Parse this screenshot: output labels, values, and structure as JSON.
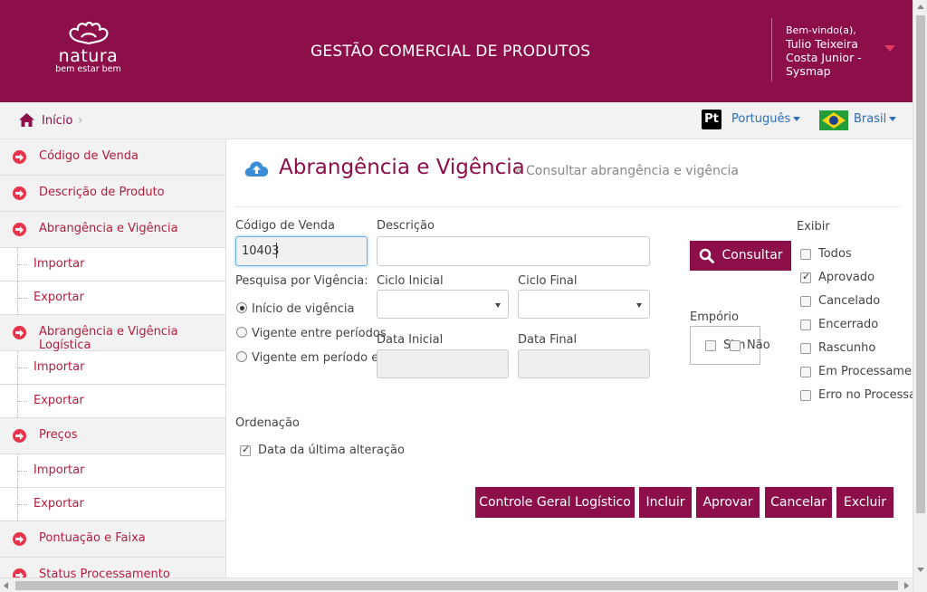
{
  "header": {
    "logo_word": "natura",
    "logo_tagline": "bem estar bem",
    "app_title": "GESTÃO COMERCIAL DE PRODUTOS",
    "welcome": "Bem-vindo(a),",
    "user_name_line1": "Tulio Teixeira",
    "user_name_line2": "Costa Junior -",
    "user_name_line3": "Sysmap"
  },
  "breadcrumb": {
    "home_label": "Início",
    "separator": "›"
  },
  "locale": {
    "language_badge": "Pt",
    "language": "Português",
    "country": "Brasil"
  },
  "sidebar": {
    "items": [
      {
        "label": "Código de Venda"
      },
      {
        "label": "Descrição de Produto"
      },
      {
        "label": "Abrangência e Vigência"
      },
      {
        "label": "Importar"
      },
      {
        "label": "Exportar"
      },
      {
        "label": "Abrangência e Vigência Logística"
      },
      {
        "label": "Importar"
      },
      {
        "label": "Exportar"
      },
      {
        "label": "Preços"
      },
      {
        "label": "Importar"
      },
      {
        "label": "Exportar"
      },
      {
        "label": "Pontuação e Faixa"
      },
      {
        "label": "Status Processamento"
      }
    ]
  },
  "page": {
    "title": "Abrangência e Vigência",
    "subtitle": "» Consultar abrangência e vigência"
  },
  "form": {
    "codigo_label": "Código de Venda",
    "codigo_value": "10403",
    "descricao_label": "Descrição",
    "descricao_value": "",
    "pesquisa_label": "Pesquisa por Vigência:",
    "radio_inicio": "Início de vigência",
    "radio_vigente_entre": "Vigente entre períodos",
    "radio_vigente_em": "Vigente em período esp",
    "ciclo_inicial_label": "Ciclo Inicial",
    "ciclo_final_label": "Ciclo Final",
    "data_inicial_label": "Data Inicial",
    "data_final_label": "Data Final",
    "consultar_label": "Consultar",
    "emporio_label": "Empório",
    "emporio_sim": "Sim",
    "emporio_nao": "Não",
    "exibir_label": "Exibir",
    "exibir_options": [
      {
        "label": "Todos",
        "checked": false
      },
      {
        "label": "Aprovado",
        "checked": true
      },
      {
        "label": "Cancelado",
        "checked": false
      },
      {
        "label": "Encerrado",
        "checked": false
      },
      {
        "label": "Rascunho",
        "checked": false
      },
      {
        "label": "Em Processamen",
        "checked": false
      },
      {
        "label": "Erro no Processa",
        "checked": false
      }
    ],
    "ordenacao_label": "Ordenação",
    "ordenacao_option": "Data da última alteração"
  },
  "actions": {
    "controle_label": "Controle Geral Logístico",
    "incluir_label": "Incluir",
    "aprovar_label": "Aprovar",
    "cancelar_label": "Cancelar",
    "excluir_label": "Excluir"
  },
  "colors": {
    "brand": "#8c0f4a",
    "sidebar_link": "#b41e3c",
    "arrow_icon": "#e8334a",
    "lang_link": "#2a6ebb"
  }
}
